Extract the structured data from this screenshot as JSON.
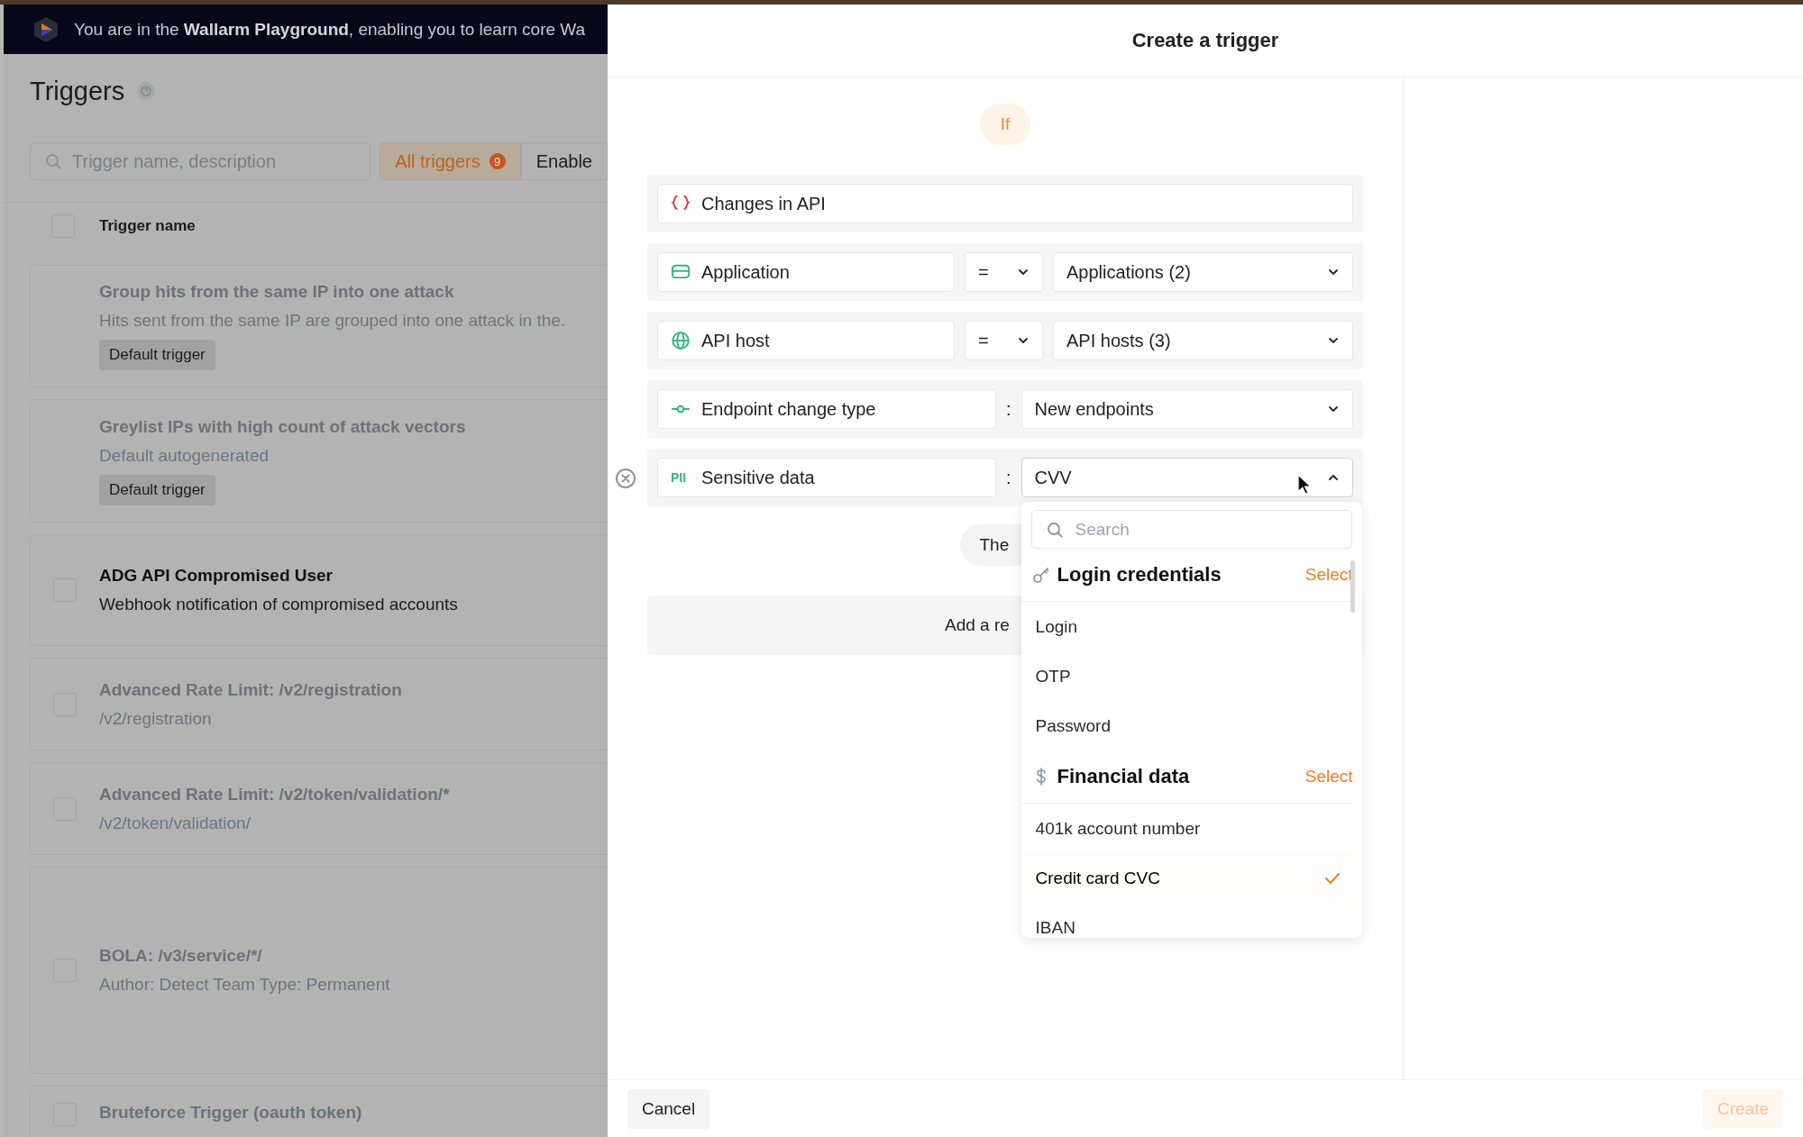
{
  "banner": {
    "text": "You are in the **Wallarm Playground**, enabling you to learn core Wa"
  },
  "page": {
    "title": "Triggers"
  },
  "search": {
    "placeholder": "Trigger name, description"
  },
  "filter_tabs": [
    {
      "label": "All triggers",
      "count": "9",
      "selected": true
    },
    {
      "label": "Enable",
      "selected": false
    }
  ],
  "table": {
    "header": "Trigger name",
    "checked": false
  },
  "triggers": [
    {
      "kind": "default",
      "title": "Group hits from the same IP into one attack",
      "description": "Hits sent from the same IP are grouped into one attack in the.",
      "badge": "Default trigger",
      "enabled": false
    },
    {
      "kind": "default",
      "title": "Greylist IPs with high count of attack vectors",
      "description": "Default autogenerated",
      "badge": "Default trigger",
      "enabled": false
    },
    {
      "kind": "custom",
      "title": "ADG API Compromised User",
      "description": "Webhook notification of compromised accounts",
      "enabled": true,
      "checked": false
    },
    {
      "kind": "custom",
      "title": "Advanced Rate Limit: /v2/registration",
      "description": "/v2/registration",
      "enabled": false,
      "checked": false
    },
    {
      "kind": "custom",
      "title": "Advanced Rate Limit: /v2/token/validation/*",
      "description": "/v2/token/validation/",
      "enabled": false,
      "checked": false
    },
    {
      "kind": "custom",
      "title": "BOLA: /v3/service/*/",
      "description": "Author: Detect Team Type: Permanent",
      "enabled": false,
      "checked": false
    },
    {
      "kind": "custom",
      "title": "Bruteforce Trigger (oauth token)",
      "enabled": false,
      "checked": false
    }
  ],
  "drawer": {
    "title": "Create a trigger",
    "if_label": "If",
    "conditions": [
      {
        "kind": "filter",
        "label": "Changes in API"
      },
      {
        "kind": "compare",
        "label": "Application",
        "operator": "=",
        "value": "Applications (2)",
        "open": false
      },
      {
        "kind": "compare",
        "label": "API host",
        "operator": "=",
        "value": "API hosts (3)",
        "open": false
      },
      {
        "kind": "select",
        "label": "Endpoint change type",
        "separator": ":",
        "value": "New endpoints",
        "open": false
      },
      {
        "kind": "select",
        "icon_text": "PII",
        "label": "Sensitive data",
        "separator": ":",
        "value": "CVV",
        "open": true,
        "removable": true
      }
    ],
    "then_label": "The",
    "add_reaction": "Add a re",
    "dropdown": {
      "search_placeholder": "Search",
      "groups": [
        {
          "title": "Login credentials",
          "action": "Select",
          "items": [
            {
              "label": "Login",
              "selected": false
            },
            {
              "label": "OTP",
              "selected": false
            },
            {
              "label": "Password",
              "selected": false
            }
          ]
        },
        {
          "title": "Financial data",
          "action": "Select",
          "items": [
            {
              "label": "401k account number",
              "selected": false
            },
            {
              "label": "Credit card CVC",
              "selected": true
            },
            {
              "label": "IBAN",
              "selected": false
            }
          ]
        }
      ]
    },
    "cancel": "Cancel",
    "create": "Create",
    "create_disabled": true
  }
}
